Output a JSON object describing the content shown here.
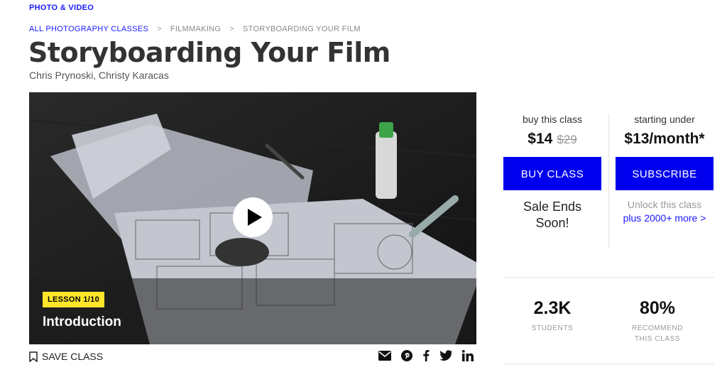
{
  "category": "PHOTO & VIDEO",
  "breadcrumb": {
    "items": [
      "ALL PHOTOGRAPHY CLASSES",
      "FILMMAKING",
      "STORYBOARDING YOUR FILM"
    ],
    "separator": ">"
  },
  "class": {
    "title": "Storyboarding Your Film",
    "authors": "Chris Prynoski, Christy Karacas"
  },
  "video": {
    "lesson_badge": "LESSON 1/10",
    "lesson_title": "Introduction"
  },
  "actions": {
    "save_label": "SAVE CLASS",
    "share_icons": [
      "email-icon",
      "pinterest-icon",
      "facebook-icon",
      "twitter-icon",
      "linkedin-icon"
    ]
  },
  "pricing": {
    "buy": {
      "label": "buy this class",
      "price": "$14",
      "original_price": "$29",
      "button": "BUY CLASS",
      "sale_text_line1": "Sale Ends",
      "sale_text_line2": "Soon!"
    },
    "subscribe": {
      "label": "starting under",
      "price": "$13/month*",
      "button": "SUBSCRIBE",
      "unlock_text": "Unlock this class",
      "more_link": "plus 2000+ more >"
    }
  },
  "stats": [
    {
      "value": "2.3K",
      "label_line1": "STUDENTS",
      "label_line2": ""
    },
    {
      "value": "80%",
      "label_line1": "RECOMMEND",
      "label_line2": "THIS CLASS"
    }
  ],
  "colors": {
    "accent": "#0000ee",
    "badge": "#ffe629",
    "link": "#1a1aff"
  }
}
